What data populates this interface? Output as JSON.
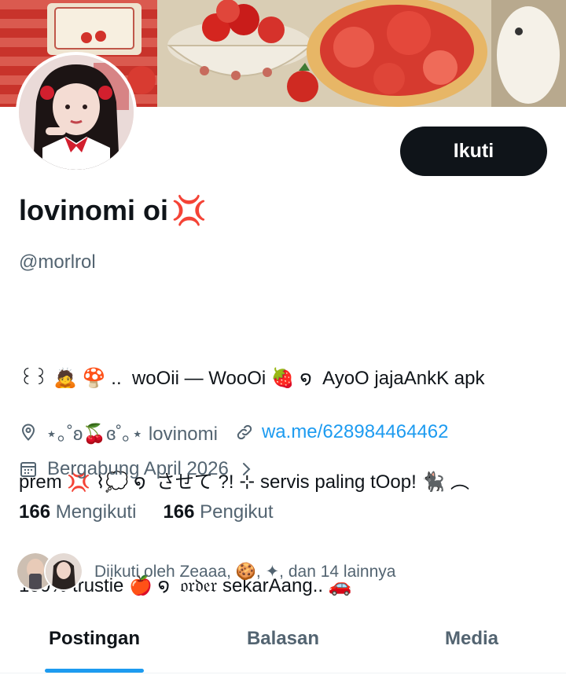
{
  "profile": {
    "display_name": "lovinomi oi",
    "name_emoji": "💢",
    "handle": "@morlrol",
    "bio_lines": [
      "꒰꒱ 🙇 🍄 ..  woOii — WooOi 🍓 ໑  AyoO jajaAnkK apk",
      "prem 💢 ⌇💭 ໑  させて ?! ⊹ servis paling tOop! 🐈‍⬛ ︵",
      "100% trustie 🍎 ໑  𝔬𝔯𝔡𝔢𝔯 sekarAang.. 🚗"
    ],
    "location": "⋆｡˚ʚ🍒ɞ˚｡⋆ lovinomi",
    "website": "wa.me/628984464462",
    "joined": "Bergabung April 2026",
    "following_count": "166",
    "following_label": "Mengikuti",
    "followers_count": "166",
    "followers_label": "Pengikut",
    "followed_by": "Diikuti oleh Zeaaa, 🍪, ✦, dan 14 lainnya"
  },
  "actions": {
    "follow_label": "Ikuti"
  },
  "tabs": [
    {
      "label": "Postingan",
      "active": true
    },
    {
      "label": "Balasan",
      "active": false
    },
    {
      "label": "Media",
      "active": false
    }
  ],
  "icons": {
    "location": "location-pin-icon",
    "link": "link-icon",
    "calendar": "calendar-icon",
    "chevron": "chevron-right-icon"
  },
  "colors": {
    "accent": "#1d9bf0",
    "text": "#0f1419",
    "secondary": "#536471",
    "button": "#0f1419"
  }
}
